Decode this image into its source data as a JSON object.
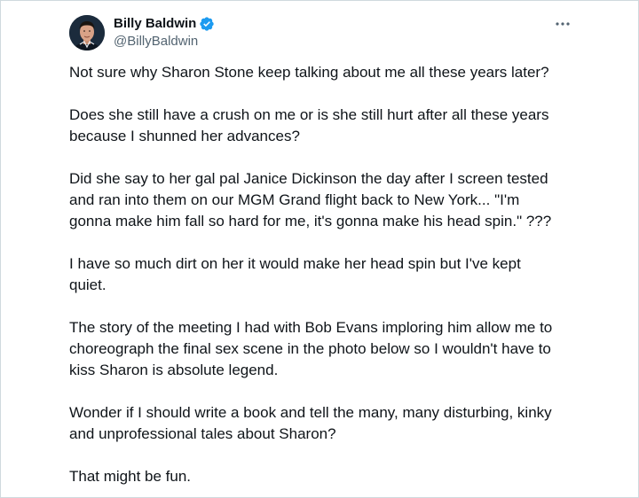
{
  "tweet": {
    "author": {
      "display_name": "Billy Baldwin",
      "handle": "@BillyBaldwin",
      "verified": true,
      "avatar_icon": "avatar-photo",
      "verified_icon": "verified-badge-icon",
      "verified_color": "#1d9bf0"
    },
    "more_icon": "more-options-icon",
    "paragraphs": [
      "Not sure why Sharon Stone keep talking about me all these years later?",
      "Does she still have a crush on me or is she still hurt after all these years\nbecause I shunned her advances?",
      "Did she say to her gal pal Janice Dickinson the day after I screen tested\nand ran into them on our MGM Grand flight back to New York... \"I'm\ngonna make him fall so hard for me, it's gonna make his head spin.\" ???",
      "I have so much dirt on her it would make her head spin but I've kept\nquiet.",
      "The story of the meeting I had with Bob Evans imploring him allow me to\nchoreograph the final sex scene in the photo below so I wouldn't have to\nkiss Sharon is absolute legend.",
      "Wonder if I should write a book and tell the many, many disturbing, kinky\nand unprofessional tales about Sharon?",
      "That might be fun."
    ]
  }
}
